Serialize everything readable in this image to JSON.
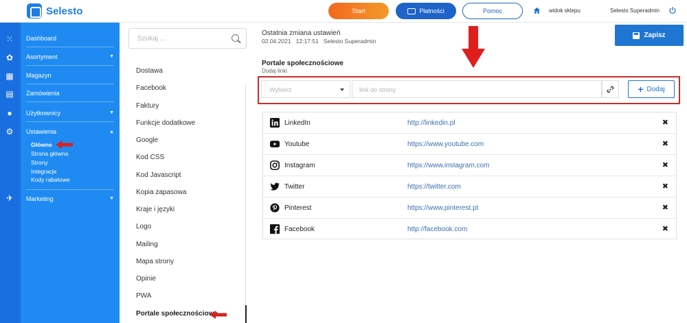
{
  "brand": {
    "name": "Selesto"
  },
  "topbar": {
    "start_label": "Start",
    "payments_label": "Płatności",
    "help_label": "Pomoc",
    "shop_view_label": "widok sklepu",
    "user_label": "Selesto Superadmin"
  },
  "sidebar": {
    "items": [
      {
        "label": "Dashboard"
      },
      {
        "label": "Asortyment",
        "caret": "▼"
      },
      {
        "label": "Magazyn"
      },
      {
        "label": "Zamówienia"
      },
      {
        "label": "Użytkownicy",
        "caret": "▼"
      },
      {
        "label": "Ustawienia",
        "caret": "▲"
      },
      {
        "label": "Marketing",
        "caret": "▼"
      }
    ],
    "submenu": [
      {
        "label": "Główne",
        "active": true
      },
      {
        "label": "Strona główna"
      },
      {
        "label": "Strony"
      },
      {
        "label": "Integracje"
      },
      {
        "label": "Kody rabatowe"
      }
    ]
  },
  "settings": {
    "search_placeholder": "Szukaj ...",
    "items": [
      "Dostawa",
      "Facebook",
      "Faktury",
      "Funkcje dodatkowe",
      "Google",
      "Kod CSS",
      "Kod Javascript",
      "Kopia zapasowa",
      "Kraje i języki",
      "Logo",
      "Mailing",
      "Mapa strony",
      "Opinie",
      "PWA",
      "Portale społecznościowe"
    ],
    "active_item": "Portale społecznościowe"
  },
  "meta": {
    "title": "Ostatnia zmiana ustawień",
    "date": "02.04.2021",
    "time": "12:17:51",
    "user": "Selesto Superadmin"
  },
  "save_label": "Zapisz",
  "section": {
    "title": "Portale społecznościowe",
    "subtitle": "Dodaj linki"
  },
  "form": {
    "select_value": "Wybierz",
    "link_placeholder": "link do strony",
    "add_label": "Dodaj"
  },
  "links": [
    {
      "name": "LinkedIn",
      "url": "http://linkedin.pl",
      "icon": "linkedin-icon"
    },
    {
      "name": "Youtube",
      "url": "https://www.youtube.com",
      "icon": "youtube-icon"
    },
    {
      "name": "Instagram",
      "url": "https://www.instagram.com",
      "icon": "instagram-icon"
    },
    {
      "name": "Twitter",
      "url": "https://twitter.com",
      "icon": "twitter-icon"
    },
    {
      "name": "Pinterest",
      "url": "https://www.pinterest.pt",
      "icon": "pinterest-icon"
    },
    {
      "name": "Facebook",
      "url": "http://facebook.com",
      "icon": "facebook-icon"
    }
  ],
  "colors": {
    "accent": "#1f8bf2",
    "rail": "#1a6fe0",
    "primary_button": "#1f76d2",
    "highlight": "#c62b2b",
    "start_gradient": "#f4671f"
  }
}
